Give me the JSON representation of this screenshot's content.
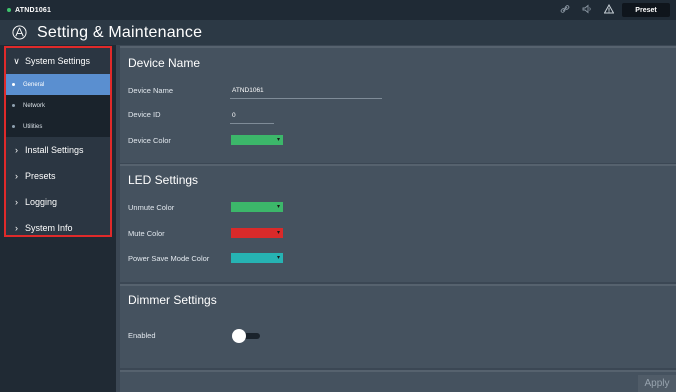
{
  "topbar": {
    "device_label": "ATND1061",
    "preset_label": "Preset",
    "icons": [
      "link-icon",
      "speaker-icon",
      "warning-icon"
    ]
  },
  "header": {
    "title": "Setting & Maintenance",
    "logo": "audio-technica-logo"
  },
  "sidebar": {
    "system_settings": "System Settings",
    "sub_items": [
      "General",
      "Network",
      "Utilities"
    ],
    "active_sub": "General",
    "install_settings": "Install Settings",
    "presets": "Presets",
    "logging": "Logging",
    "system_info": "System Info"
  },
  "device_name_section": {
    "title": "Device Name",
    "device_name_label": "Device Name",
    "device_name_value": "ATND1061",
    "device_id_label": "Device ID",
    "device_id_value": "0",
    "device_color_label": "Device Color",
    "device_color": "#3cb76a"
  },
  "led_section": {
    "title": "LED Settings",
    "unmute_label": "Unmute Color",
    "unmute_color": "#3cb76a",
    "mute_label": "Mute Color",
    "mute_color": "#d92a2a",
    "power_save_label": "Power Save Mode Color",
    "power_save_color": "#26b3b3"
  },
  "dimmer_section": {
    "title": "Dimmer Settings",
    "enabled_label": "Enabled",
    "enabled": false
  },
  "footer": {
    "apply_label": "Apply"
  },
  "colors": {
    "accent": "#5a8fd0",
    "highlight_border": "#e02a2a",
    "status_dot": "#3ec46d"
  }
}
